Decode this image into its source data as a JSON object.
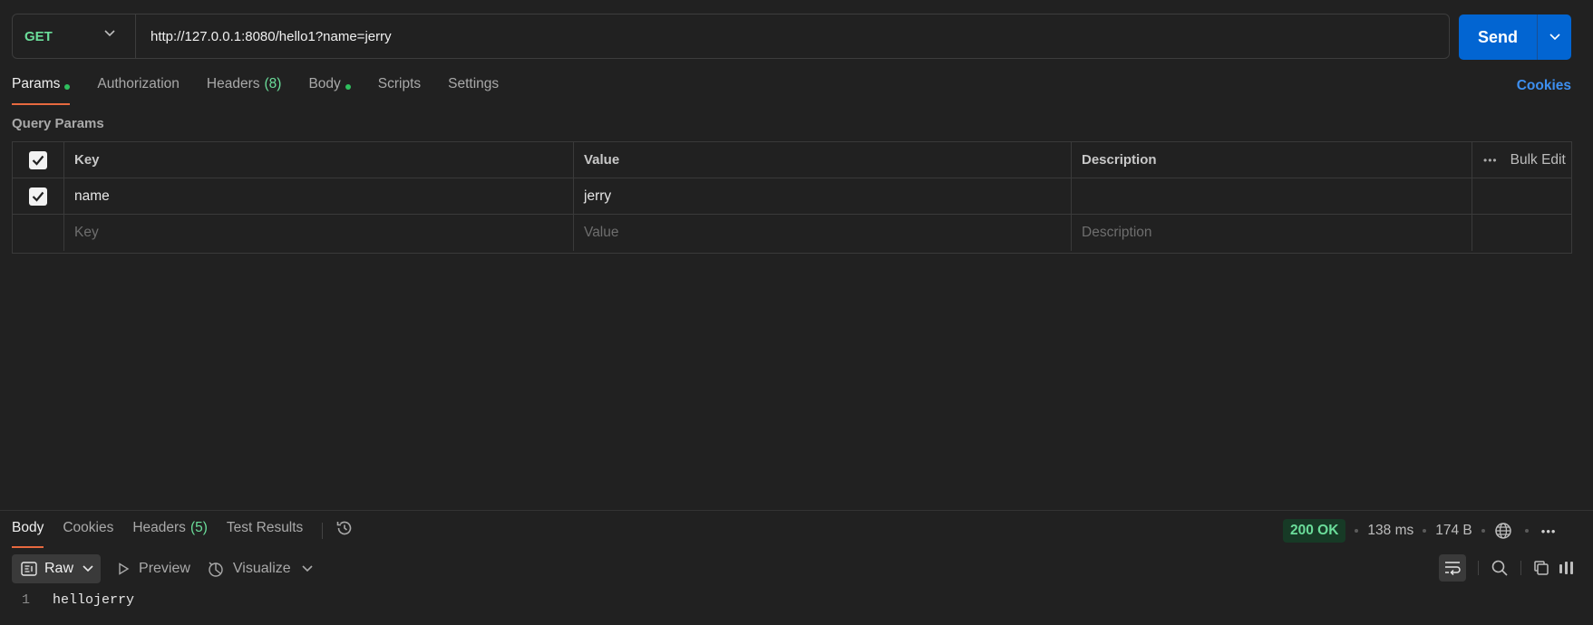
{
  "request": {
    "method": "GET",
    "url": "http://127.0.0.1:8080/hello1?name=jerry",
    "send_label": "Send"
  },
  "request_tabs": [
    {
      "label": "Params",
      "dot": true,
      "active": true
    },
    {
      "label": "Authorization"
    },
    {
      "label": "Headers",
      "count": "(8)"
    },
    {
      "label": "Body",
      "dot": true
    },
    {
      "label": "Scripts"
    },
    {
      "label": "Settings"
    }
  ],
  "cookies_link": "Cookies",
  "query_params": {
    "title": "Query Params",
    "headers": {
      "key": "Key",
      "value": "Value",
      "description": "Description",
      "bulk_edit": "Bulk Edit"
    },
    "rows": [
      {
        "checked": true,
        "key": "name",
        "value": "jerry",
        "description": ""
      }
    ],
    "placeholder": {
      "key": "Key",
      "value": "Value",
      "description": "Description"
    }
  },
  "response_tabs": [
    {
      "label": "Body",
      "active": true
    },
    {
      "label": "Cookies"
    },
    {
      "label": "Headers",
      "count": "(5)"
    },
    {
      "label": "Test Results"
    }
  ],
  "response_stats": {
    "status": "200 OK",
    "time": "138 ms",
    "size": "174 B"
  },
  "body_toolbar": {
    "format": "Raw",
    "preview": "Preview",
    "visualize": "Visualize"
  },
  "body_lines": [
    {
      "number": "1",
      "text": "hellojerry"
    }
  ],
  "colors": {
    "accent_green": "#6bdd9a",
    "send_blue": "#0265d2",
    "link_blue": "#3d8ff0",
    "tab_underline": "#e7693f"
  }
}
